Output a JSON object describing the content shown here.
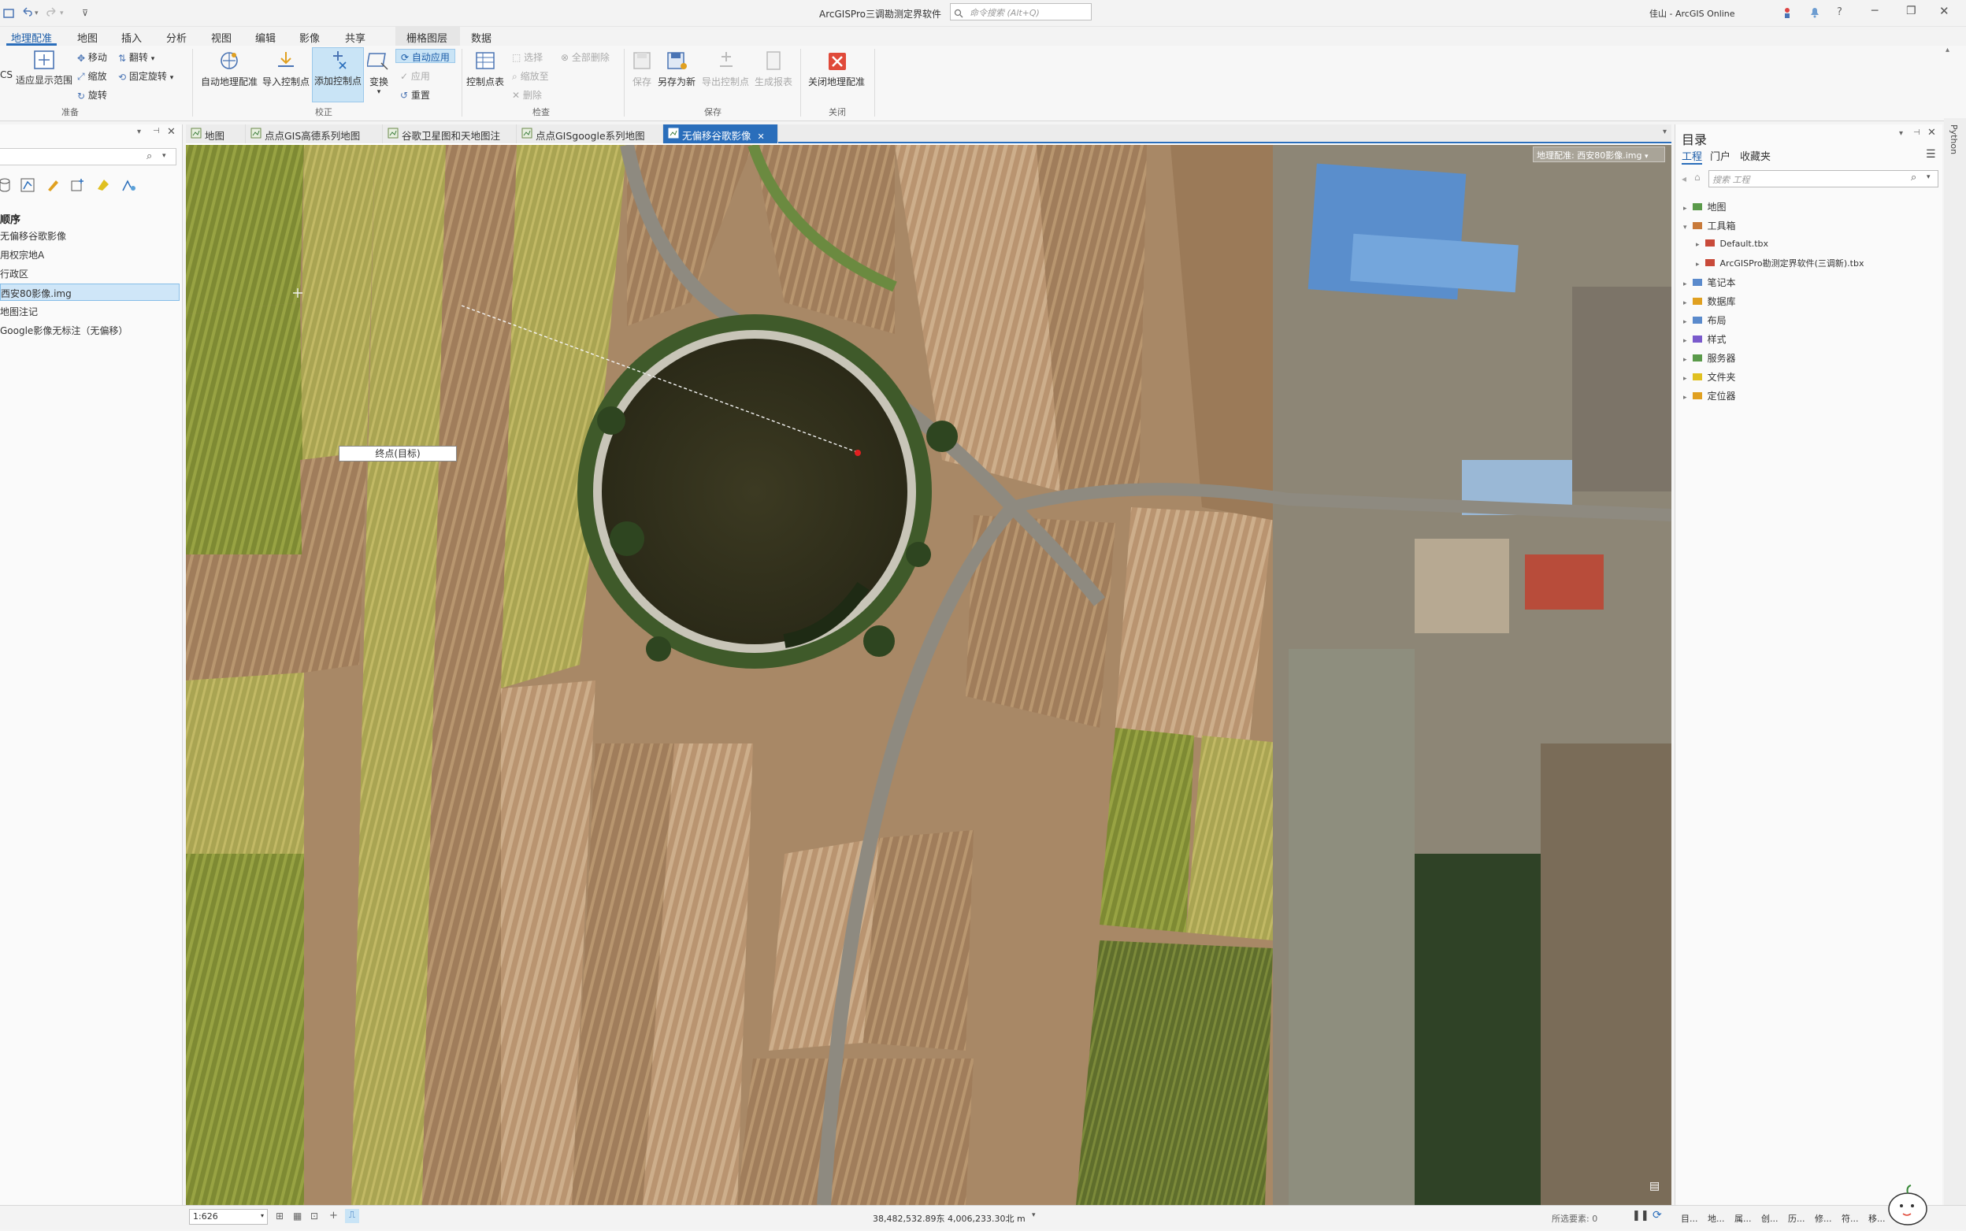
{
  "window": {
    "title": "ArcGISPro三调勘测定界软件",
    "search_placeholder": "命令搜索 (Alt+Q)",
    "user": "佳山 - ArcGIS Online",
    "help": "?"
  },
  "ribbon_tabs": [
    "地理配准",
    "地图",
    "插入",
    "分析",
    "视图",
    "编辑",
    "影像",
    "共享",
    "栅格图层",
    "数据"
  ],
  "ribbon": {
    "fit_label": "适应显示范围",
    "move": "移动",
    "flip": "翻转",
    "scale": "缩放",
    "fixed_rotate": "固定旋转",
    "rotate": "旋转",
    "auto_georef": "自动地理配准",
    "import_cp": "导入控制点",
    "add_cp": "添加控制点",
    "transform": "变换",
    "auto_apply": "自动应用",
    "apply": "应用",
    "reset": "重置",
    "cp_table": "控制点表",
    "select": "选择",
    "zoom_to": "缩放至",
    "delete": "删除",
    "delete_all": "全部删除",
    "save": "保存",
    "save_as_new": "另存为新",
    "export_cp": "导出控制点",
    "gen_report": "生成报表",
    "close_georef": "关闭地理配准",
    "groups": {
      "prepare": "准备",
      "correct": "校正",
      "inspect": "检查",
      "save": "保存",
      "close": "关闭"
    },
    "cs_fragment": "CS"
  },
  "contents": {
    "heading": "顺序",
    "layers": [
      "无偏移谷歌影像",
      "用权宗地A",
      "行政区",
      "西安80影像.img",
      "地图注记",
      "Google影像无标注（无偏移）"
    ],
    "selected_index": 3
  },
  "map_tabs": [
    {
      "label": "地图",
      "active": false
    },
    {
      "label": "点点GIS高德系列地图",
      "active": false
    },
    {
      "label": "谷歌卫星图和天地图注记",
      "active": false
    },
    {
      "label": "点点GISgoogle系列地图",
      "active": false
    },
    {
      "label": "无偏移谷歌影像",
      "active": true
    }
  ],
  "map": {
    "target_selector": "地理配准: 西安80影像.img",
    "endpoint_label": "终点(目标)"
  },
  "catalog": {
    "title": "目录",
    "tabs": [
      "工程",
      "门户",
      "收藏夹"
    ],
    "search_placeholder": "搜索 工程",
    "items": [
      "地图",
      "工具箱",
      "Default.tbx",
      "ArcGISPro勘测定界软件(三调新).tbx",
      "笔记本",
      "数据库",
      "布局",
      "样式",
      "服务器",
      "文件夹",
      "定位器"
    ]
  },
  "python_label": "Python",
  "status": {
    "scale": "1:626",
    "coords": "38,482,532.89东 4,006,233.30北 m",
    "selected_features": "所选要素: 0",
    "bottom_tabs": [
      "目...",
      "地...",
      "属...",
      "创...",
      "历...",
      "修...",
      "符...",
      "移..."
    ]
  }
}
